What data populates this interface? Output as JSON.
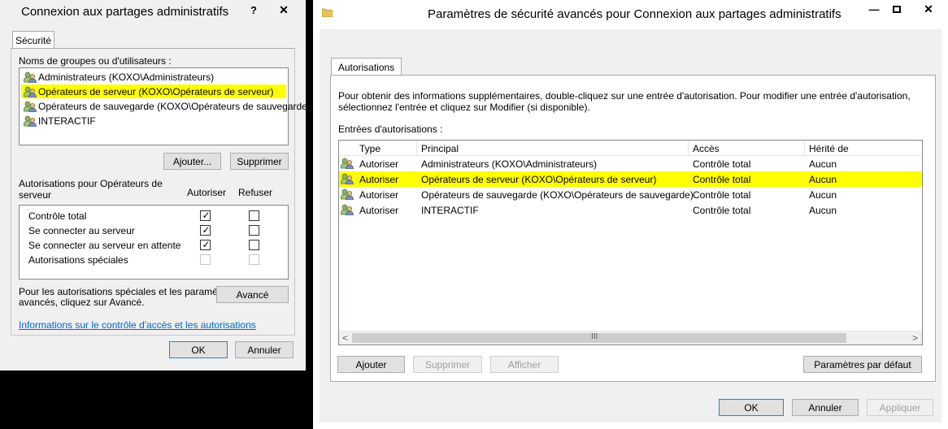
{
  "dialog1": {
    "title": "Connexion aux partages administratifs",
    "help_glyph": "?",
    "close_glyph": "✕",
    "tab": "Sécurité",
    "groups_label": "Noms de groupes ou d'utilisateurs :",
    "users": [
      {
        "label": "Administrateurs (KOXO\\Administrateurs)",
        "selected": false
      },
      {
        "label": "Opérateurs de serveur (KOXO\\Opérateurs de serveur)",
        "selected": true
      },
      {
        "label": "Opérateurs de sauvegarde (KOXO\\Opérateurs de sauvegarde)",
        "selected": false
      },
      {
        "label": "INTERACTIF",
        "selected": false
      }
    ],
    "add_button": "Ajouter...",
    "remove_button": "Supprimer",
    "perm_label_line1": "Autorisations pour Opérateurs de",
    "perm_label_line2": "serveur",
    "allow_header": "Autoriser",
    "deny_header": "Refuser",
    "permissions": [
      {
        "label": "Contrôle total",
        "allow": true,
        "deny": false,
        "disabled": false
      },
      {
        "label": "Se connecter au serveur",
        "allow": true,
        "deny": false,
        "disabled": false
      },
      {
        "label": "Se connecter au serveur en attente",
        "allow": true,
        "deny": false,
        "disabled": false
      },
      {
        "label": "Autorisations spéciales",
        "allow": false,
        "deny": false,
        "disabled": true
      }
    ],
    "advanced_text_line1": "Pour les autorisations spéciales et les paramètres",
    "advanced_text_line2": "avancés, cliquez sur Avancé.",
    "advanced_button": "Avancé",
    "info_link": "Informations sur le contrôle d'accès et les autorisations",
    "ok_button": "OK",
    "cancel_button": "Annuler",
    "tick": "✓"
  },
  "dialog2": {
    "title": "Paramètres de sécurité avancés pour Connexion aux partages administratifs",
    "minimize_glyph": "—",
    "maximize_glyph": "☐",
    "close_glyph": "✕",
    "tab": "Autorisations",
    "info_line1": "Pour obtenir des informations supplémentaires, double-cliquez sur une entrée d'autorisation. Pour modifier une entrée d'autorisation,",
    "info_line2": "sélectionnez l'entrée et cliquez sur Modifier (si disponible).",
    "entries_label": "Entrées d'autorisations :",
    "columns": [
      "Type",
      "Principal",
      "Accès",
      "Hérité de"
    ],
    "rows": [
      {
        "type": "Autoriser",
        "principal": "Administrateurs (KOXO\\Administrateurs)",
        "access": "Contrôle total",
        "inherited": "Aucun",
        "selected": false
      },
      {
        "type": "Autoriser",
        "principal": "Opérateurs de serveur (KOXO\\Opérateurs de serveur)",
        "access": "Contrôle total",
        "inherited": "Aucun",
        "selected": true
      },
      {
        "type": "Autoriser",
        "principal": "Opérateurs de sauvegarde (KOXO\\Opérateurs de sauvegarde)",
        "access": "Contrôle total",
        "inherited": "Aucun",
        "selected": false
      },
      {
        "type": "Autoriser",
        "principal": "INTERACTIF",
        "access": "Contrôle total",
        "inherited": "Aucun",
        "selected": false
      }
    ],
    "scroll_left": "<",
    "scroll_right": ">",
    "scroll_thumb": "III",
    "add_button": "Ajouter",
    "remove_button": "Supprimer",
    "view_button": "Afficher",
    "defaults_button": "Paramètres par défaut",
    "ok_button": "OK",
    "cancel_button": "Annuler",
    "apply_button": "Appliquer"
  },
  "colors": {
    "highlight": "#ffff00",
    "link": "#0066cc",
    "window_bg": "#f0f0f0"
  }
}
